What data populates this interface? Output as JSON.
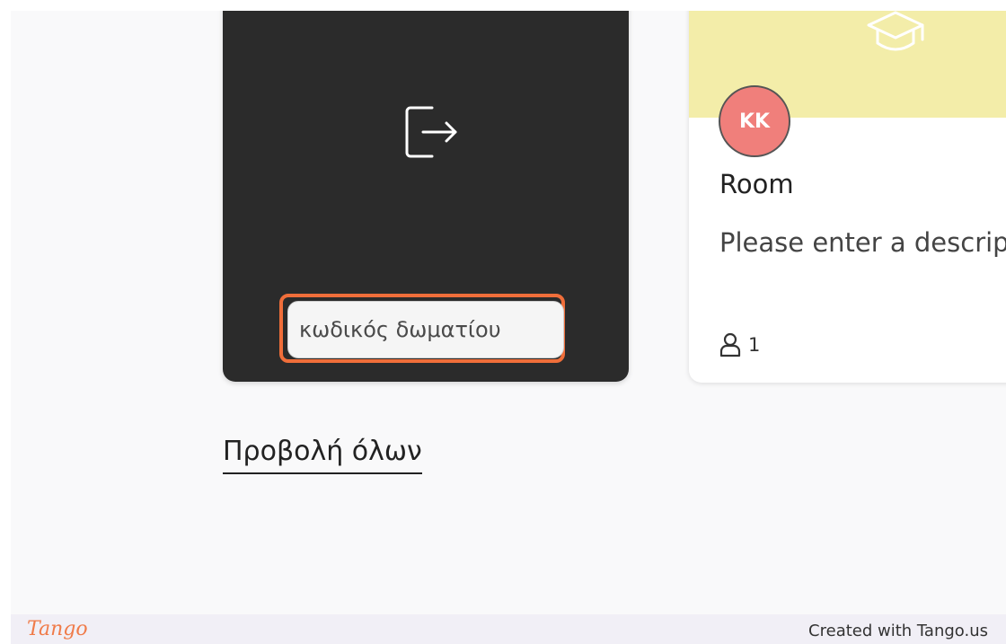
{
  "join_card": {
    "room_code_placeholder": "κωδικός δωματίου",
    "icon": "enter-room-icon"
  },
  "room_card": {
    "banner_color": "#f3eda9",
    "banner_icon": "graduation-cap-icon",
    "avatar_initials": "KK",
    "avatar_color": "#f07f7b",
    "title": "Room",
    "description": "Please enter a description",
    "member_icon": "user-icon",
    "member_count": "1"
  },
  "view_all_label": "Προβολή όλων",
  "highlight_color": "#f06e3a",
  "footer": {
    "logo_text": "Tango",
    "created_with": "Created with Tango.us"
  }
}
